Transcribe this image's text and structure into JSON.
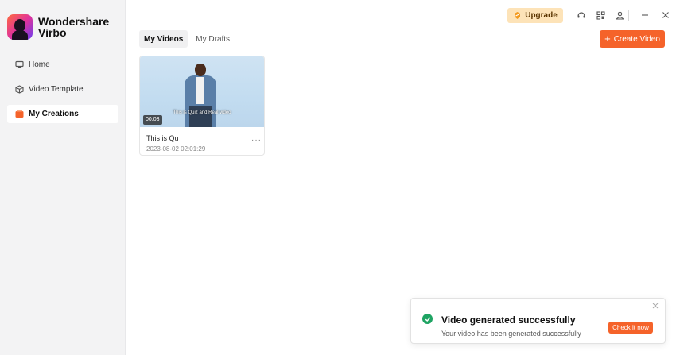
{
  "app": {
    "name_line1": "Wondershare",
    "name_line2": "Virbo"
  },
  "sidebar": {
    "items": [
      {
        "label": "Home",
        "icon": "monitor-icon",
        "active": false
      },
      {
        "label": "Video Template",
        "icon": "cube-icon",
        "active": false
      },
      {
        "label": "My Creations",
        "icon": "creations-icon",
        "active": true
      }
    ]
  },
  "topbar": {
    "upgrade_label": "Upgrade",
    "icons": [
      "headset-icon",
      "grid-icon",
      "user-icon",
      "minimize-icon",
      "close-icon"
    ]
  },
  "tabs": [
    {
      "label": "My Videos",
      "active": true
    },
    {
      "label": "My Drafts",
      "active": false
    }
  ],
  "create_button": {
    "label": "Create Video"
  },
  "videos": [
    {
      "title": "This is Qu",
      "date": "2023-08-02 02:01:29",
      "duration": "00:03",
      "subtitle": "This is Quiz and Real video"
    }
  ],
  "toast": {
    "title": "Video generated successfully",
    "message": "Your video has been generated successfully",
    "button": "Check it now"
  },
  "colors": {
    "accent": "#f5632a",
    "success": "#1fa463",
    "upgrade_bg": "#fde3b8",
    "sidebar_bg": "#f3f3f4"
  }
}
